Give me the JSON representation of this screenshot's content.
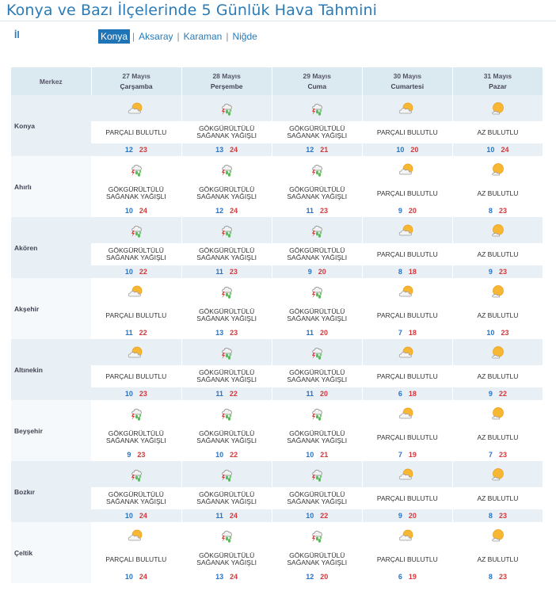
{
  "page": {
    "title": "Konya ve Bazı İlçelerinde 5 Günlük Hava Tahmini",
    "il_label": "İl",
    "tabs": [
      {
        "label": "Konya",
        "active": true
      },
      {
        "label": "Aksaray",
        "active": false
      },
      {
        "label": "Karaman",
        "active": false
      },
      {
        "label": "Niğde",
        "active": false
      }
    ],
    "separator": "|"
  },
  "colors": {
    "title": "#2a7bb8",
    "header_bg": "#dbe9f1",
    "row_band": "#e8f0f5",
    "tmin": "#2a73c0",
    "tmax": "#d2393c",
    "active_tab": "#1f74b5"
  },
  "header": {
    "merkez_label": "Merkez",
    "days": [
      {
        "date": "27 Mayıs",
        "day": "Çarşamba"
      },
      {
        "date": "28 Mayıs",
        "day": "Perşembe"
      },
      {
        "date": "29 Mayıs",
        "day": "Cuma"
      },
      {
        "date": "30 Mayıs",
        "day": "Cumartesi"
      },
      {
        "date": "31 Mayıs",
        "day": "Pazar"
      }
    ]
  },
  "conditions": {
    "parcali": {
      "line1": "PARÇALI BULUTLU",
      "line2": "",
      "icon": "partly-cloudy-icon"
    },
    "az": {
      "line1": "AZ BULUTLU",
      "line2": "",
      "icon": "mostly-sunny-icon"
    },
    "gok": {
      "line1": "GÖKGÜRÜLTÜLÜ",
      "line2": "SAĞANAK YAĞIŞLI",
      "icon": "thunderstorm-icon"
    }
  },
  "rows": [
    {
      "city": "Konya",
      "days": [
        {
          "cond": "parcali",
          "min": "12",
          "max": "23"
        },
        {
          "cond": "gok",
          "min": "13",
          "max": "24"
        },
        {
          "cond": "gok",
          "min": "12",
          "max": "21"
        },
        {
          "cond": "parcali",
          "min": "10",
          "max": "20"
        },
        {
          "cond": "az",
          "min": "10",
          "max": "24"
        }
      ]
    },
    {
      "city": "Ahırlı",
      "days": [
        {
          "cond": "gok",
          "min": "10",
          "max": "24"
        },
        {
          "cond": "gok",
          "min": "12",
          "max": "24"
        },
        {
          "cond": "gok",
          "min": "11",
          "max": "23"
        },
        {
          "cond": "parcali",
          "min": "9",
          "max": "20"
        },
        {
          "cond": "az",
          "min": "8",
          "max": "23"
        }
      ]
    },
    {
      "city": "Akören",
      "days": [
        {
          "cond": "gok",
          "min": "10",
          "max": "22"
        },
        {
          "cond": "gok",
          "min": "11",
          "max": "23"
        },
        {
          "cond": "gok",
          "min": "9",
          "max": "20"
        },
        {
          "cond": "parcali",
          "min": "8",
          "max": "18"
        },
        {
          "cond": "az",
          "min": "9",
          "max": "23"
        }
      ]
    },
    {
      "city": "Akşehir",
      "days": [
        {
          "cond": "parcali",
          "min": "11",
          "max": "22"
        },
        {
          "cond": "gok",
          "min": "13",
          "max": "23"
        },
        {
          "cond": "gok",
          "min": "11",
          "max": "20"
        },
        {
          "cond": "parcali",
          "min": "7",
          "max": "18"
        },
        {
          "cond": "az",
          "min": "10",
          "max": "23"
        }
      ]
    },
    {
      "city": "Altınekin",
      "days": [
        {
          "cond": "parcali",
          "min": "10",
          "max": "23"
        },
        {
          "cond": "gok",
          "min": "11",
          "max": "22"
        },
        {
          "cond": "gok",
          "min": "11",
          "max": "20"
        },
        {
          "cond": "parcali",
          "min": "6",
          "max": "18"
        },
        {
          "cond": "az",
          "min": "9",
          "max": "22"
        }
      ]
    },
    {
      "city": "Beyşehir",
      "days": [
        {
          "cond": "gok",
          "min": "9",
          "max": "23"
        },
        {
          "cond": "gok",
          "min": "10",
          "max": "22"
        },
        {
          "cond": "gok",
          "min": "10",
          "max": "21"
        },
        {
          "cond": "parcali",
          "min": "7",
          "max": "19"
        },
        {
          "cond": "az",
          "min": "7",
          "max": "23"
        }
      ]
    },
    {
      "city": "Bozkır",
      "days": [
        {
          "cond": "gok",
          "min": "10",
          "max": "24"
        },
        {
          "cond": "gok",
          "min": "11",
          "max": "24"
        },
        {
          "cond": "gok",
          "min": "10",
          "max": "22"
        },
        {
          "cond": "parcali",
          "min": "9",
          "max": "20"
        },
        {
          "cond": "az",
          "min": "8",
          "max": "23"
        }
      ]
    },
    {
      "city": "Çeltik",
      "days": [
        {
          "cond": "parcali",
          "min": "10",
          "max": "24"
        },
        {
          "cond": "gok",
          "min": "13",
          "max": "24"
        },
        {
          "cond": "gok",
          "min": "12",
          "max": "20"
        },
        {
          "cond": "parcali",
          "min": "6",
          "max": "19"
        },
        {
          "cond": "az",
          "min": "8",
          "max": "23"
        }
      ]
    }
  ]
}
